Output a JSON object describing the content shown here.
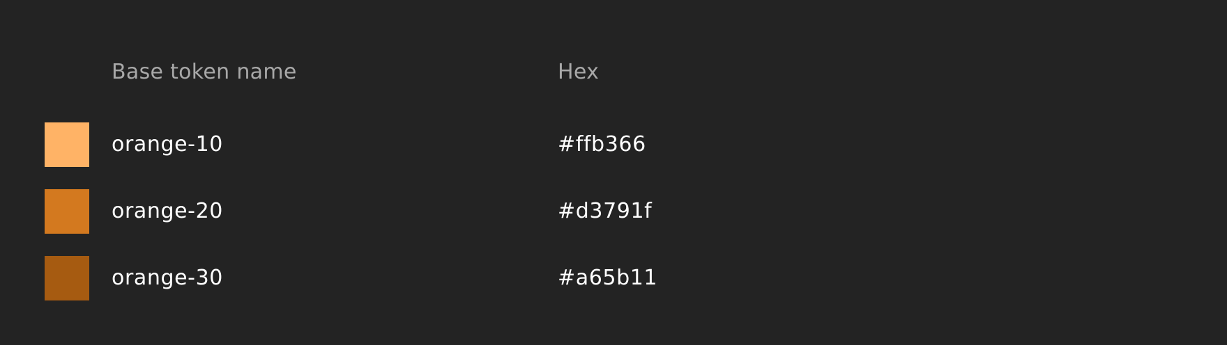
{
  "table": {
    "columns": {
      "name": "Base token name",
      "hex": "Hex"
    },
    "rows": [
      {
        "name": "orange-10",
        "hex": "#ffb366",
        "swatch_color": "#ffb366"
      },
      {
        "name": "orange-20",
        "hex": "#d3791f",
        "swatch_color": "#d3791f"
      },
      {
        "name": "orange-30",
        "hex": "#a65b11",
        "swatch_color": "#a65b11"
      }
    ]
  }
}
